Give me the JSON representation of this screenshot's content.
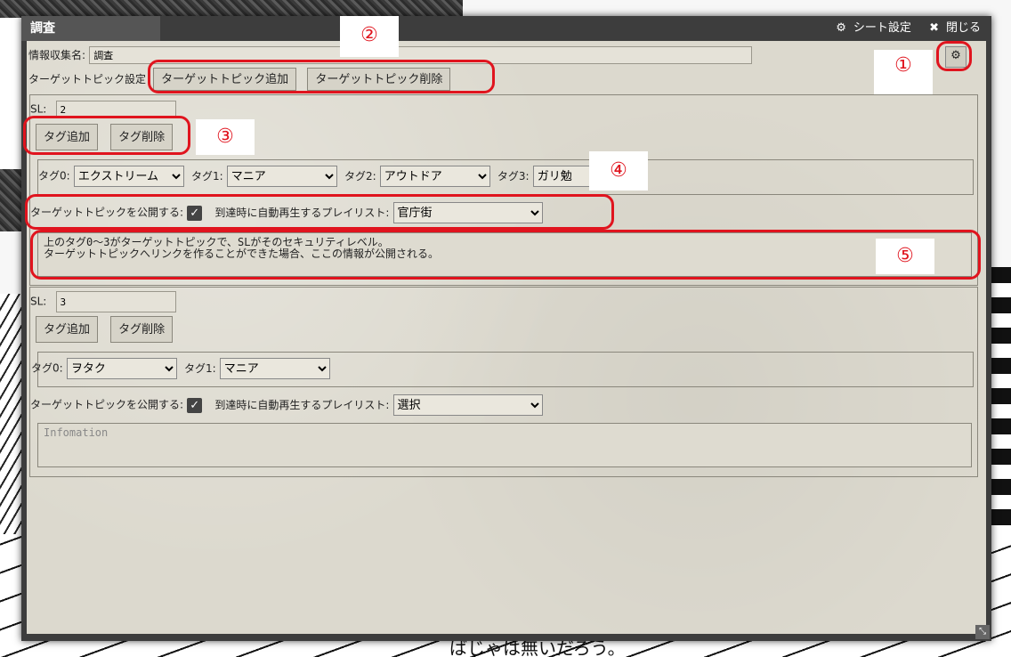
{
  "window": {
    "title": "調査",
    "sheet_settings": "シート設定",
    "close": "閉じる"
  },
  "form": {
    "collection_name_label": "情報収集名:",
    "collection_name_value": "調査",
    "target_topic_label": "ターゲットトピック設定",
    "add_topic": "ターゲットトピック追加",
    "remove_topic": "ターゲットトピック削除"
  },
  "topics": [
    {
      "sl_label": "SL:",
      "sl_value": "2",
      "add_tag": "タグ追加",
      "remove_tag": "タグ削除",
      "tags": [
        {
          "label": "タグ0:",
          "value": "エクストリーム"
        },
        {
          "label": "タグ1:",
          "value": "マニア"
        },
        {
          "label": "タグ2:",
          "value": "アウトドア"
        },
        {
          "label": "タグ3:",
          "value": "ガリ勉"
        }
      ],
      "publish_label": "ターゲットトピックを公開する:",
      "publish_checked": true,
      "playlist_label": "到達時に自動再生するプレイリスト:",
      "playlist_value": "官庁街",
      "info_text": "上のタグ0～3がターゲットトピックで、SLがそのセキュリティレベル。\nターゲットトピックへリンクを作ることができた場合、ここの情報が公開される。",
      "info_placeholder": "Infomation"
    },
    {
      "sl_label": "SL:",
      "sl_value": "3",
      "add_tag": "タグ追加",
      "remove_tag": "タグ削除",
      "tags": [
        {
          "label": "タグ0:",
          "value": "ヲタク"
        },
        {
          "label": "タグ1:",
          "value": "マニア"
        }
      ],
      "publish_label": "ターゲットトピックを公開する:",
      "publish_checked": true,
      "playlist_label": "到達時に自動再生するプレイリスト:",
      "playlist_value": "選択",
      "info_text": "",
      "info_placeholder": "Infomation"
    }
  ],
  "annotations": [
    "①",
    "②",
    "③",
    "④",
    "⑤"
  ],
  "background": {
    "text": "ばじゃは無いだろう。"
  },
  "icons": {
    "gear": "gear-icon",
    "sheet_settings": "gear-icon",
    "close": "close-icon",
    "checkbox": "check-icon",
    "resize": "resize-icon"
  },
  "colors": {
    "annotation": "#e0141e",
    "titlebar": "#3d3d3d",
    "panel": "#dcd9ce"
  }
}
